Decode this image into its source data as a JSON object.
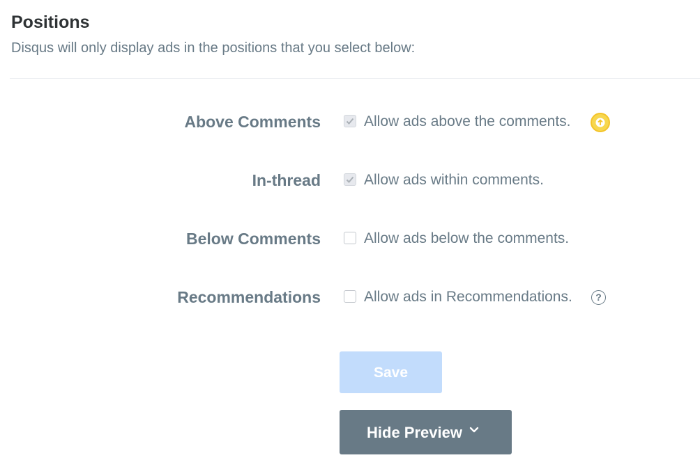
{
  "header": {
    "title": "Positions",
    "subtitle": "Disqus will only display ads in the positions that you select below:"
  },
  "positions": [
    {
      "label": "Above Comments",
      "text": "Allow ads above the comments.",
      "checked": true,
      "icon": "upgrade-arrow-icon"
    },
    {
      "label": "In-thread",
      "text": "Allow ads within comments.",
      "checked": true
    },
    {
      "label": "Below Comments",
      "text": "Allow ads below the comments.",
      "checked": false
    },
    {
      "label": "Recommendations",
      "text": "Allow ads in Recommendations.",
      "checked": false,
      "icon": "help-icon"
    }
  ],
  "help_glyph": "?",
  "buttons": {
    "save_label": "Save",
    "preview_label": "Hide Preview"
  },
  "colors": {
    "text_muted": "#687a86",
    "save_disabled": "#c2dcfc",
    "preview_button": "#687a86",
    "upgrade_badge": "#f7d74f"
  }
}
